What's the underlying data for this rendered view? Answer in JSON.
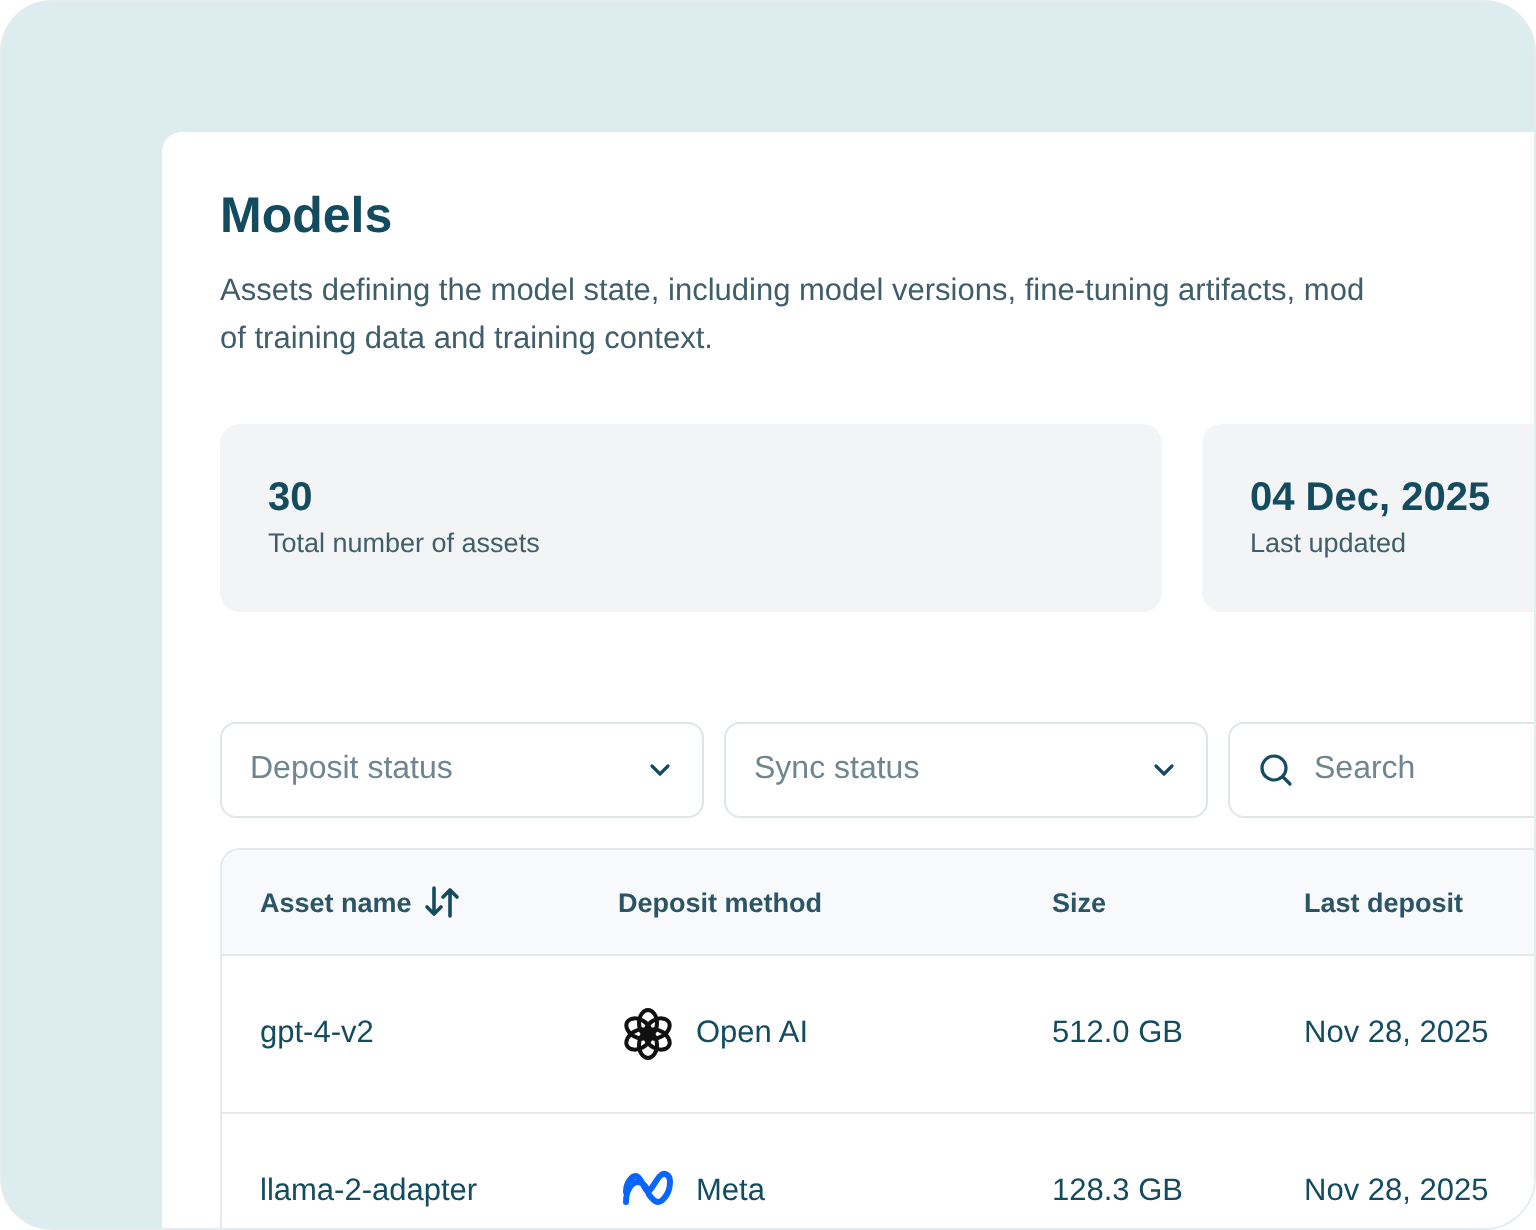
{
  "page": {
    "title": "Models",
    "description_lines": [
      "Assets defining the model state, including model versions, fine-tuning artifacts, mod",
      "of training data and training context."
    ]
  },
  "stats": [
    {
      "value": "30",
      "label": "Total number of assets"
    },
    {
      "value": "04 Dec, 2025",
      "label": "Last updated"
    }
  ],
  "filters": [
    {
      "kind": "dropdown",
      "placeholder": "Deposit status"
    },
    {
      "kind": "dropdown",
      "placeholder": "Sync status"
    },
    {
      "kind": "search",
      "placeholder": "Search"
    }
  ],
  "table": {
    "columns": [
      {
        "label": "Asset name",
        "sortable": true
      },
      {
        "label": "Deposit method",
        "sortable": false
      },
      {
        "label": "Size",
        "sortable": false
      },
      {
        "label": "Last deposit",
        "sortable": false
      }
    ],
    "rows": [
      {
        "asset_name": "gpt-4-v2",
        "method": {
          "kind": "openai",
          "label": "Open AI"
        },
        "size": "512.0 GB",
        "last_deposit": "Nov 28, 2025"
      },
      {
        "asset_name": "llama-2-adapter",
        "method": {
          "kind": "meta",
          "label": "Meta"
        },
        "size": "128.3 GB",
        "last_deposit": "Nov 28, 2025"
      }
    ]
  }
}
